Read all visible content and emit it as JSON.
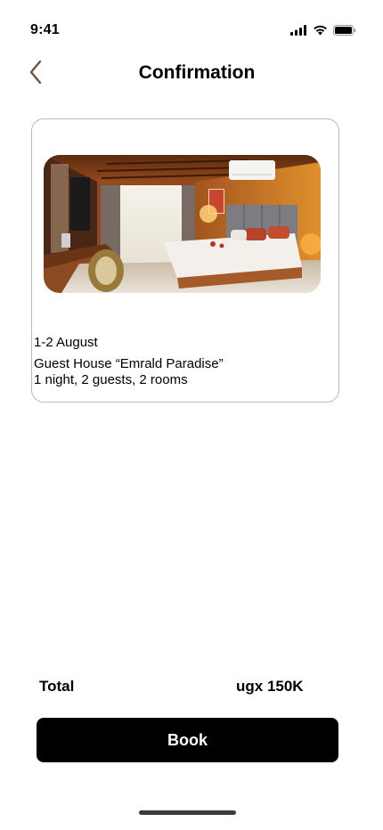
{
  "status_bar": {
    "time": "9:41",
    "icons": [
      "signal-icon",
      "wifi-icon",
      "battery-icon"
    ]
  },
  "header": {
    "back_icon": "chevron-left-icon",
    "title": "Confirmation"
  },
  "booking": {
    "image": "hotel-room-photo",
    "dates": "1-2 August",
    "property": "Guest House “Emrald Paradise”",
    "details": "1 night, 2 guests, 2 rooms"
  },
  "summary": {
    "total_label": "Total",
    "total_value": "ugx 150K"
  },
  "actions": {
    "book_label": "Book"
  },
  "colors": {
    "back_icon": "#6b5446",
    "card_border": "#b9b9b9",
    "button_bg": "#000000",
    "button_text": "#ffffff"
  }
}
